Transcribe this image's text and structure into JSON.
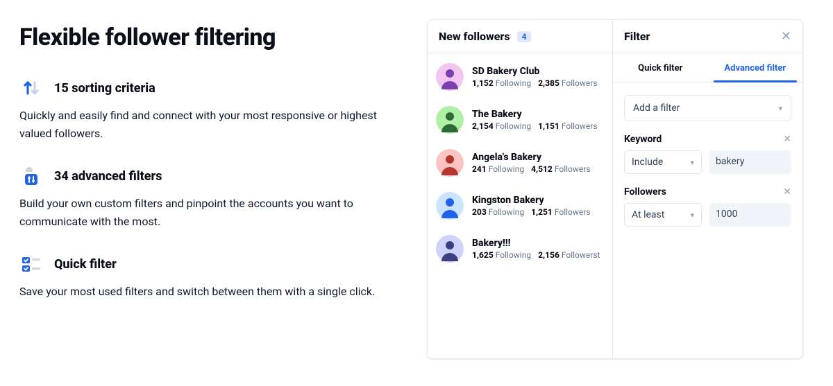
{
  "title": "Flexible follower filtering",
  "features": [
    {
      "heading": "15 sorting criteria",
      "desc": "Quickly and easily find and connect with your most responsive or highest valued followers."
    },
    {
      "heading": "34 advanced filters",
      "desc": "Build your own custom filters and pinpoint the accounts you want to communicate with the most."
    },
    {
      "heading": "Quick filter",
      "desc": "Save your most used filters and switch between them with a single click."
    }
  ],
  "followers_panel": {
    "title": "New followers",
    "count": "4",
    "following_label": "Following",
    "followers_label": "Followers",
    "items": [
      {
        "name": "SD Bakery Club",
        "following": "1,152",
        "followers": "2,385",
        "avatar_bg": "#f3c6f0",
        "avatar_fg": "#7b3fae"
      },
      {
        "name": "The Bakery",
        "following": "2,154",
        "followers": "1,151",
        "avatar_bg": "#aef0a6",
        "avatar_fg": "#2f6b3a"
      },
      {
        "name": "Angela's Bakery",
        "following": "241",
        "followers": "4,512",
        "avatar_bg": "#fbc4c0",
        "avatar_fg": "#b3362f"
      },
      {
        "name": "Kingston Bakery",
        "following": "203",
        "followers": "1,251",
        "avatar_bg": "#cbe4ff",
        "avatar_fg": "#2163e8"
      },
      {
        "name": "Bakery!!!",
        "following": "1,625",
        "followers": "2,156",
        "followers_suffix": "Followerst",
        "avatar_bg": "#cfd3f7",
        "avatar_fg": "#3b3f82"
      }
    ]
  },
  "filter_panel": {
    "title": "Filter",
    "tabs": {
      "quick": "Quick filter",
      "advanced": "Advanced filter"
    },
    "add_filter": "Add a filter",
    "keyword": {
      "label": "Keyword",
      "mode": "Include",
      "value": "bakery"
    },
    "followers": {
      "label": "Followers",
      "mode": "At least",
      "value": "1000"
    }
  }
}
